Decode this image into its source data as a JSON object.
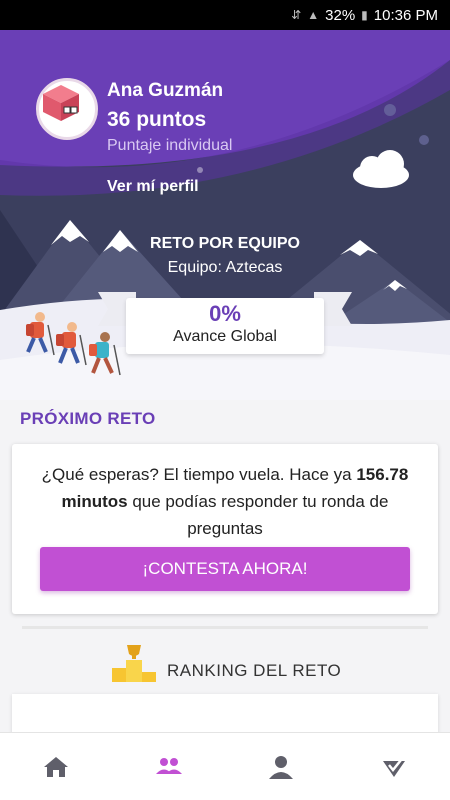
{
  "status_bar": {
    "battery": "32%",
    "time": "10:36 PM"
  },
  "user": {
    "name": "Ana Guzmán",
    "points": "36 puntos",
    "subtitle": "Puntaje individual",
    "profile_link": "Ver mí perfil"
  },
  "team": {
    "title": "RETO POR EQUIPO",
    "name": "Equipo: Aztecas"
  },
  "progress": {
    "value": "0%",
    "label": "Avance Global"
  },
  "next_challenge": {
    "section_title": "PRÓXIMO RETO",
    "text_before": "¿Qué esperas? El tiempo vuela. Hace ya ",
    "minutes": "156.78 minutos",
    "text_after": " que podías responder tu ronda de preguntas",
    "button": "¡CONTESTA AHORA!"
  },
  "ranking": {
    "title": "RANKING DEL RETO"
  },
  "colors": {
    "purple": "#6a3fb6",
    "cta": "#c150d3",
    "mountains": "#3b3f5e"
  },
  "nav": {
    "items": [
      "home-icon",
      "team-icon",
      "profile-icon",
      "quiz-icon"
    ],
    "active": "team-icon"
  }
}
